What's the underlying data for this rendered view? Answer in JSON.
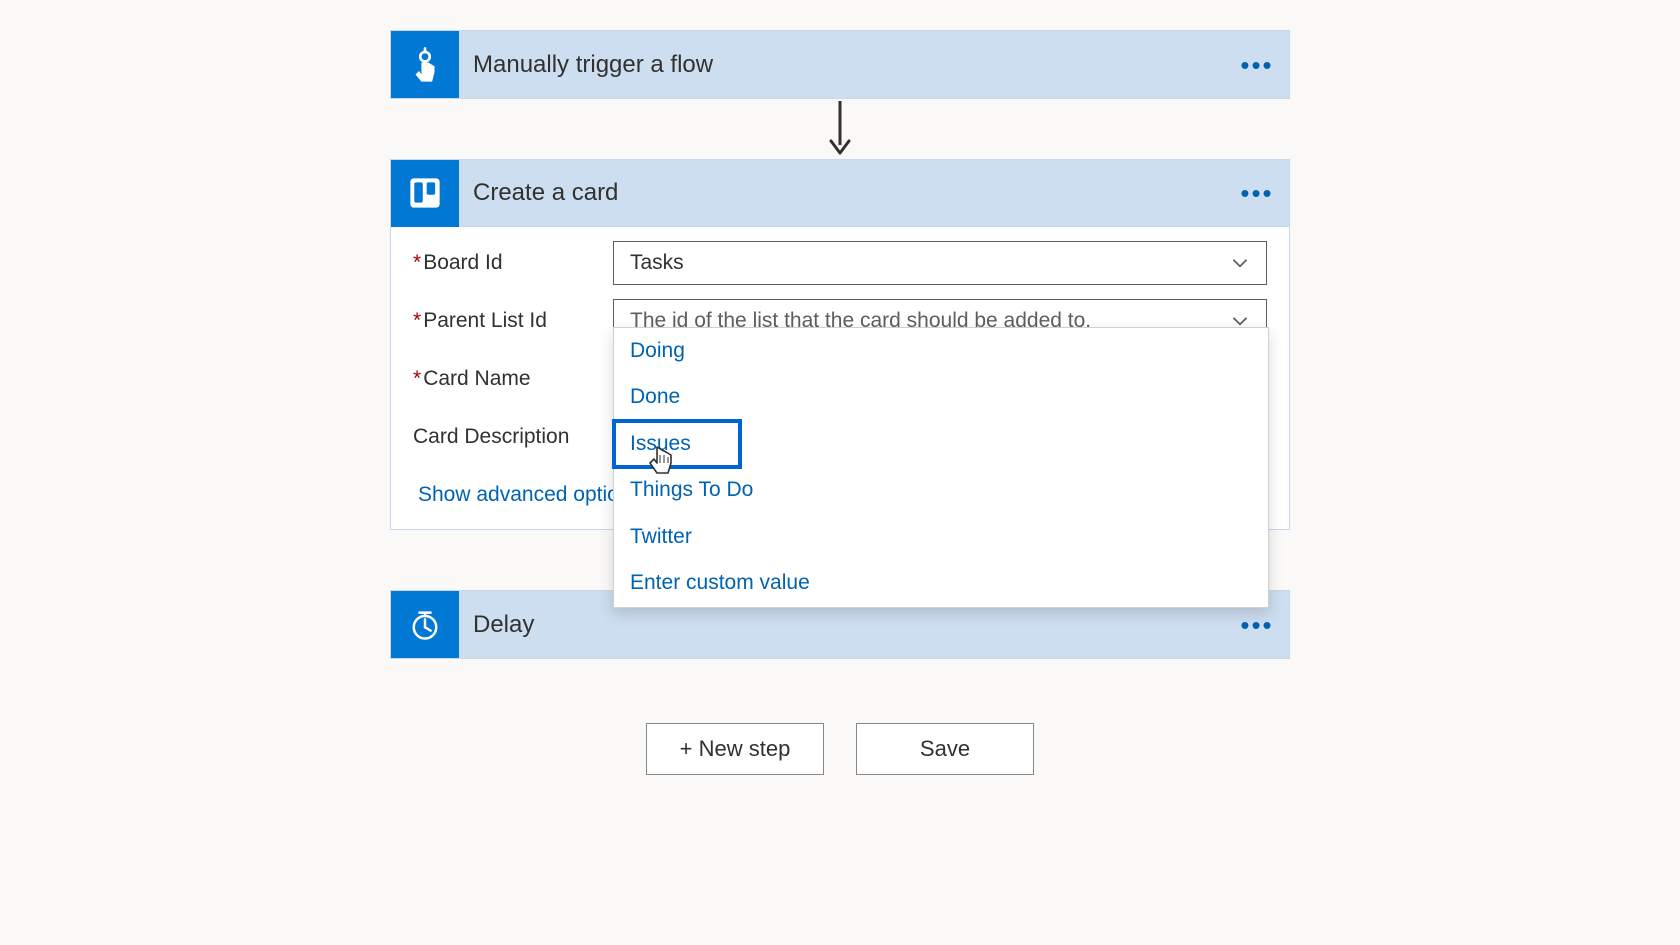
{
  "trigger": {
    "title": "Manually trigger a flow"
  },
  "createCard": {
    "title": "Create a card",
    "fields": {
      "boardId": {
        "label": "Board Id",
        "value": "Tasks"
      },
      "parentListId": {
        "label": "Parent List Id",
        "placeholder": "The id of the list that the card should be added to."
      },
      "cardName": {
        "label": "Card Name"
      },
      "cardDescription": {
        "label": "Card Description"
      }
    },
    "dropdownOptions": [
      "Doing",
      "Done",
      "Issues",
      "Things To Do",
      "Twitter",
      "Enter custom value"
    ],
    "highlightedOption": "Issues",
    "showAdvanced": "Show advanced options"
  },
  "delay": {
    "title": "Delay"
  },
  "footer": {
    "newStep": "+ New step",
    "save": "Save"
  }
}
